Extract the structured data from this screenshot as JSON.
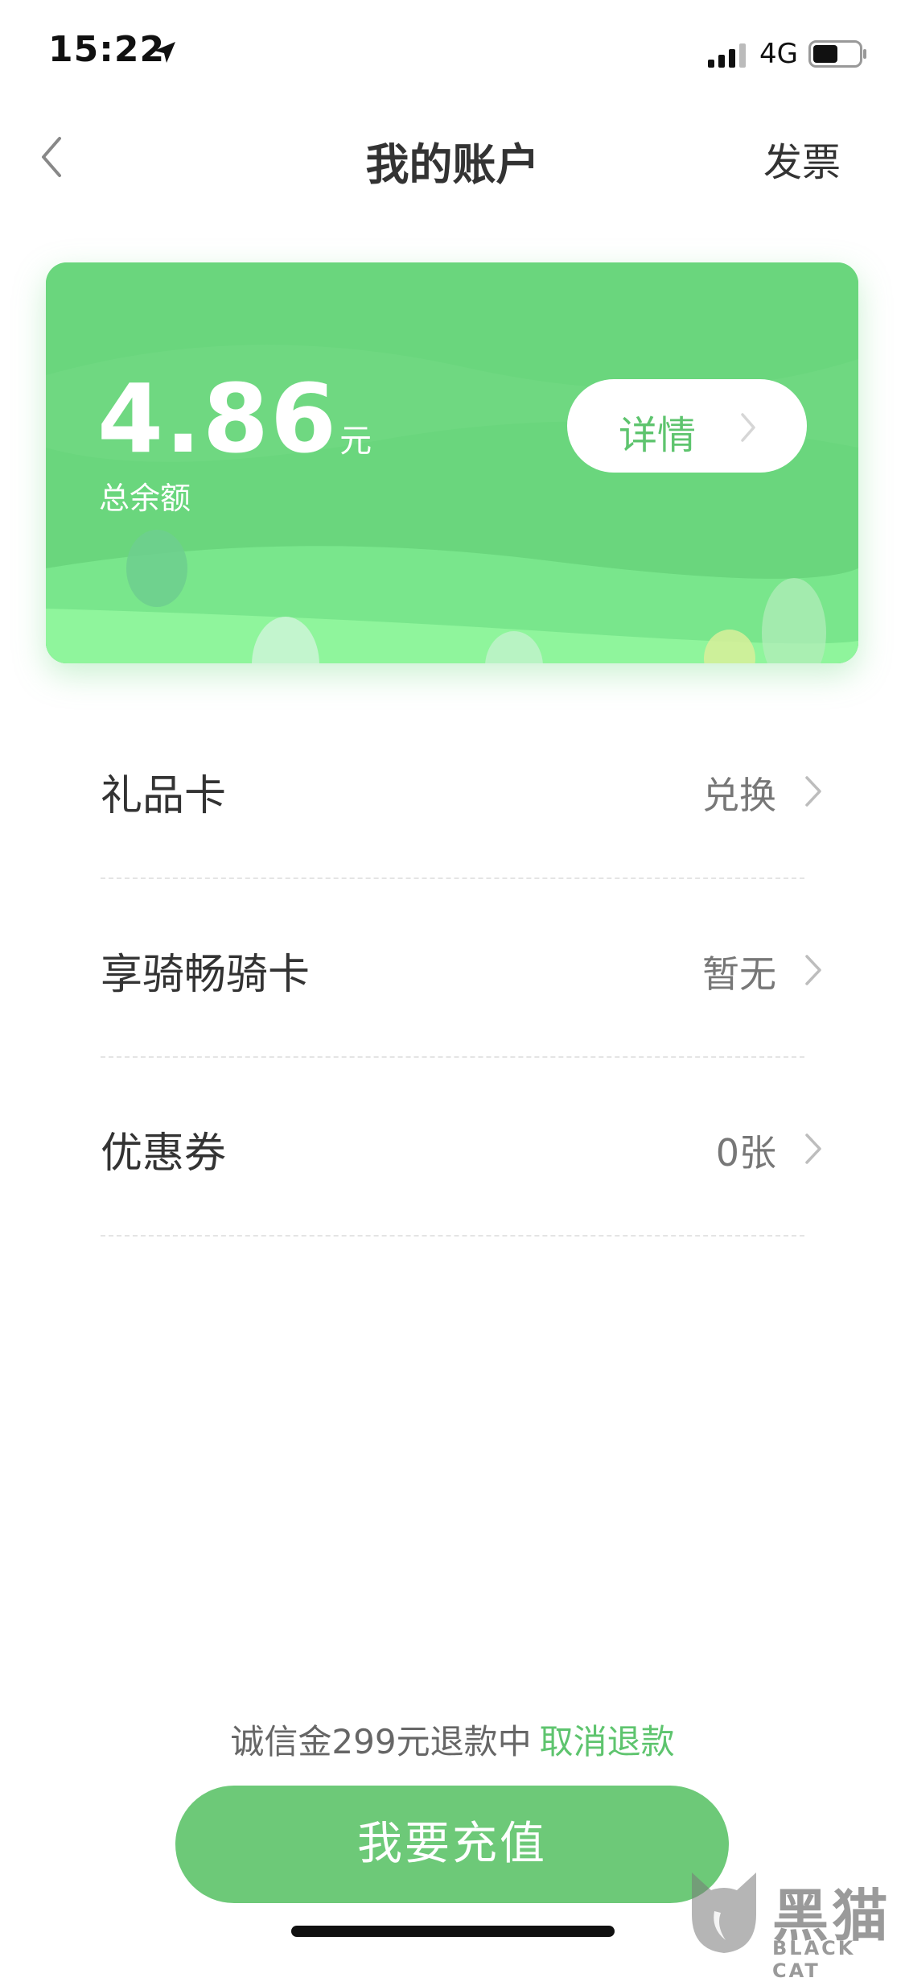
{
  "status_bar": {
    "time": "15:22",
    "location_icon": "location-arrow-icon",
    "signal_icon": "cellular-signal-icon",
    "network": "4G",
    "battery_icon": "battery-icon"
  },
  "nav": {
    "back_icon": "chevron-left-icon",
    "title": "我的账户",
    "action": "发票"
  },
  "balance_card": {
    "amount": "4.86",
    "unit": "元",
    "label": "总余额",
    "detail_button": "详情",
    "detail_icon": "chevron-right-icon"
  },
  "list": {
    "items": [
      {
        "title": "礼品卡",
        "value": "兑换"
      },
      {
        "title": "享骑畅骑卡",
        "value": "暂无"
      },
      {
        "title": "优惠券",
        "value": "0张"
      }
    ]
  },
  "footer": {
    "deposit_text": "诚信金299元退款中",
    "cancel_refund_link": "取消退款",
    "recharge_button": "我要充值"
  },
  "watermark": {
    "text_cn": "黑猫",
    "text_en": "BLACK CAT",
    "icon": "black-cat-logo-icon"
  },
  "colors": {
    "accent_green": "#5ec46e",
    "card_green": "#6ad67d",
    "button_green": "#6dc978"
  }
}
